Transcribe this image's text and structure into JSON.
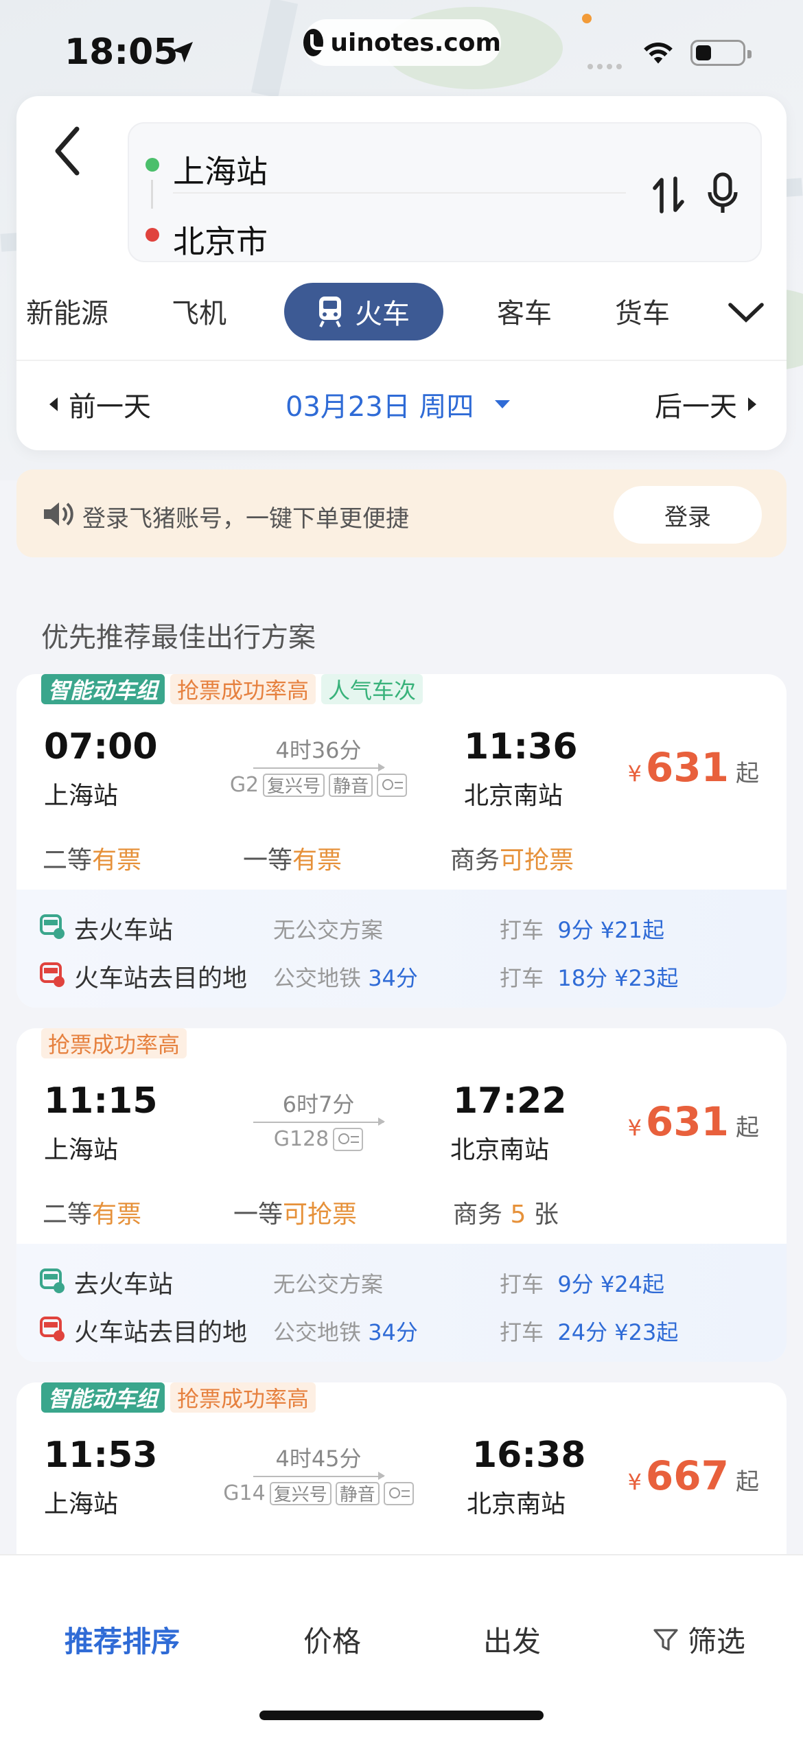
{
  "status_bar": {
    "time": "18:05",
    "url": "uinotes.com"
  },
  "route": {
    "from": "上海站",
    "to": "北京市"
  },
  "modes": [
    "新能源",
    "飞机",
    "火车",
    "客车",
    "货车"
  ],
  "active_mode": "火车",
  "date_nav": {
    "prev": "前一天",
    "current": "03月23日 周四",
    "next": "后一天"
  },
  "login_banner": {
    "text": "登录飞猪账号，一键下单更便捷",
    "button": "登录"
  },
  "section_title": "优先推荐最佳出行方案",
  "trains": [
    {
      "tags": [
        {
          "text": "智能动车组",
          "type": "smart"
        },
        {
          "text": "抢票成功率高",
          "type": "rate"
        },
        {
          "text": "人气车次",
          "type": "popular"
        }
      ],
      "dep_time": "07:00",
      "dep_station": "上海站",
      "duration": "4时36分",
      "train_no": "G2",
      "badges": [
        "复兴号",
        "静音"
      ],
      "arr_time": "11:36",
      "arr_station": "北京南站",
      "price_symbol": "¥",
      "price": "631",
      "price_suffix": "起",
      "seats": [
        {
          "class": "二等",
          "status": "有票"
        },
        {
          "class": "一等",
          "status": "有票"
        },
        {
          "class": "商务",
          "status": "可抢票"
        }
      ],
      "to_station": {
        "label": "去火车站",
        "bus": "无公交方案",
        "bus_time": "",
        "taxi": "打车",
        "taxi_time": "9分",
        "taxi_price": "¥21起"
      },
      "from_station": {
        "label": "火车站去目的地",
        "bus": "公交地铁",
        "bus_time": "34分",
        "taxi": "打车",
        "taxi_time": "18分",
        "taxi_price": "¥23起"
      }
    },
    {
      "tags": [
        {
          "text": "抢票成功率高",
          "type": "rate"
        }
      ],
      "dep_time": "11:15",
      "dep_station": "上海站",
      "duration": "6时7分",
      "train_no": "G128",
      "badges": [],
      "arr_time": "17:22",
      "arr_station": "北京南站",
      "price_symbol": "¥",
      "price": "631",
      "price_suffix": "起",
      "seats": [
        {
          "class": "二等",
          "status": "有票"
        },
        {
          "class": "一等",
          "status": "可抢票"
        },
        {
          "class": "商务",
          "status": "5",
          "suffix": "张"
        }
      ],
      "to_station": {
        "label": "去火车站",
        "bus": "无公交方案",
        "bus_time": "",
        "taxi": "打车",
        "taxi_time": "9分",
        "taxi_price": "¥24起"
      },
      "from_station": {
        "label": "火车站去目的地",
        "bus": "公交地铁",
        "bus_time": "34分",
        "taxi": "打车",
        "taxi_time": "24分",
        "taxi_price": "¥23起"
      }
    },
    {
      "tags": [
        {
          "text": "智能动车组",
          "type": "smart"
        },
        {
          "text": "抢票成功率高",
          "type": "rate"
        }
      ],
      "dep_time": "11:53",
      "dep_station": "上海站",
      "duration": "4时45分",
      "train_no": "G14",
      "badges": [
        "复兴号",
        "静音"
      ],
      "arr_time": "16:38",
      "arr_station": "北京南站",
      "price_symbol": "¥",
      "price": "667",
      "price_suffix": "起"
    }
  ],
  "bottom_bar": {
    "sort_recommend": "推荐排序",
    "sort_price": "价格",
    "sort_depart": "出发",
    "filter": "筛选"
  },
  "colors": {
    "accent_blue": "#2f6bd6",
    "mode_active": "#3d5a94",
    "price": "#e8603c",
    "available": "#e6913a",
    "smart_tag": "#3aa68c"
  }
}
